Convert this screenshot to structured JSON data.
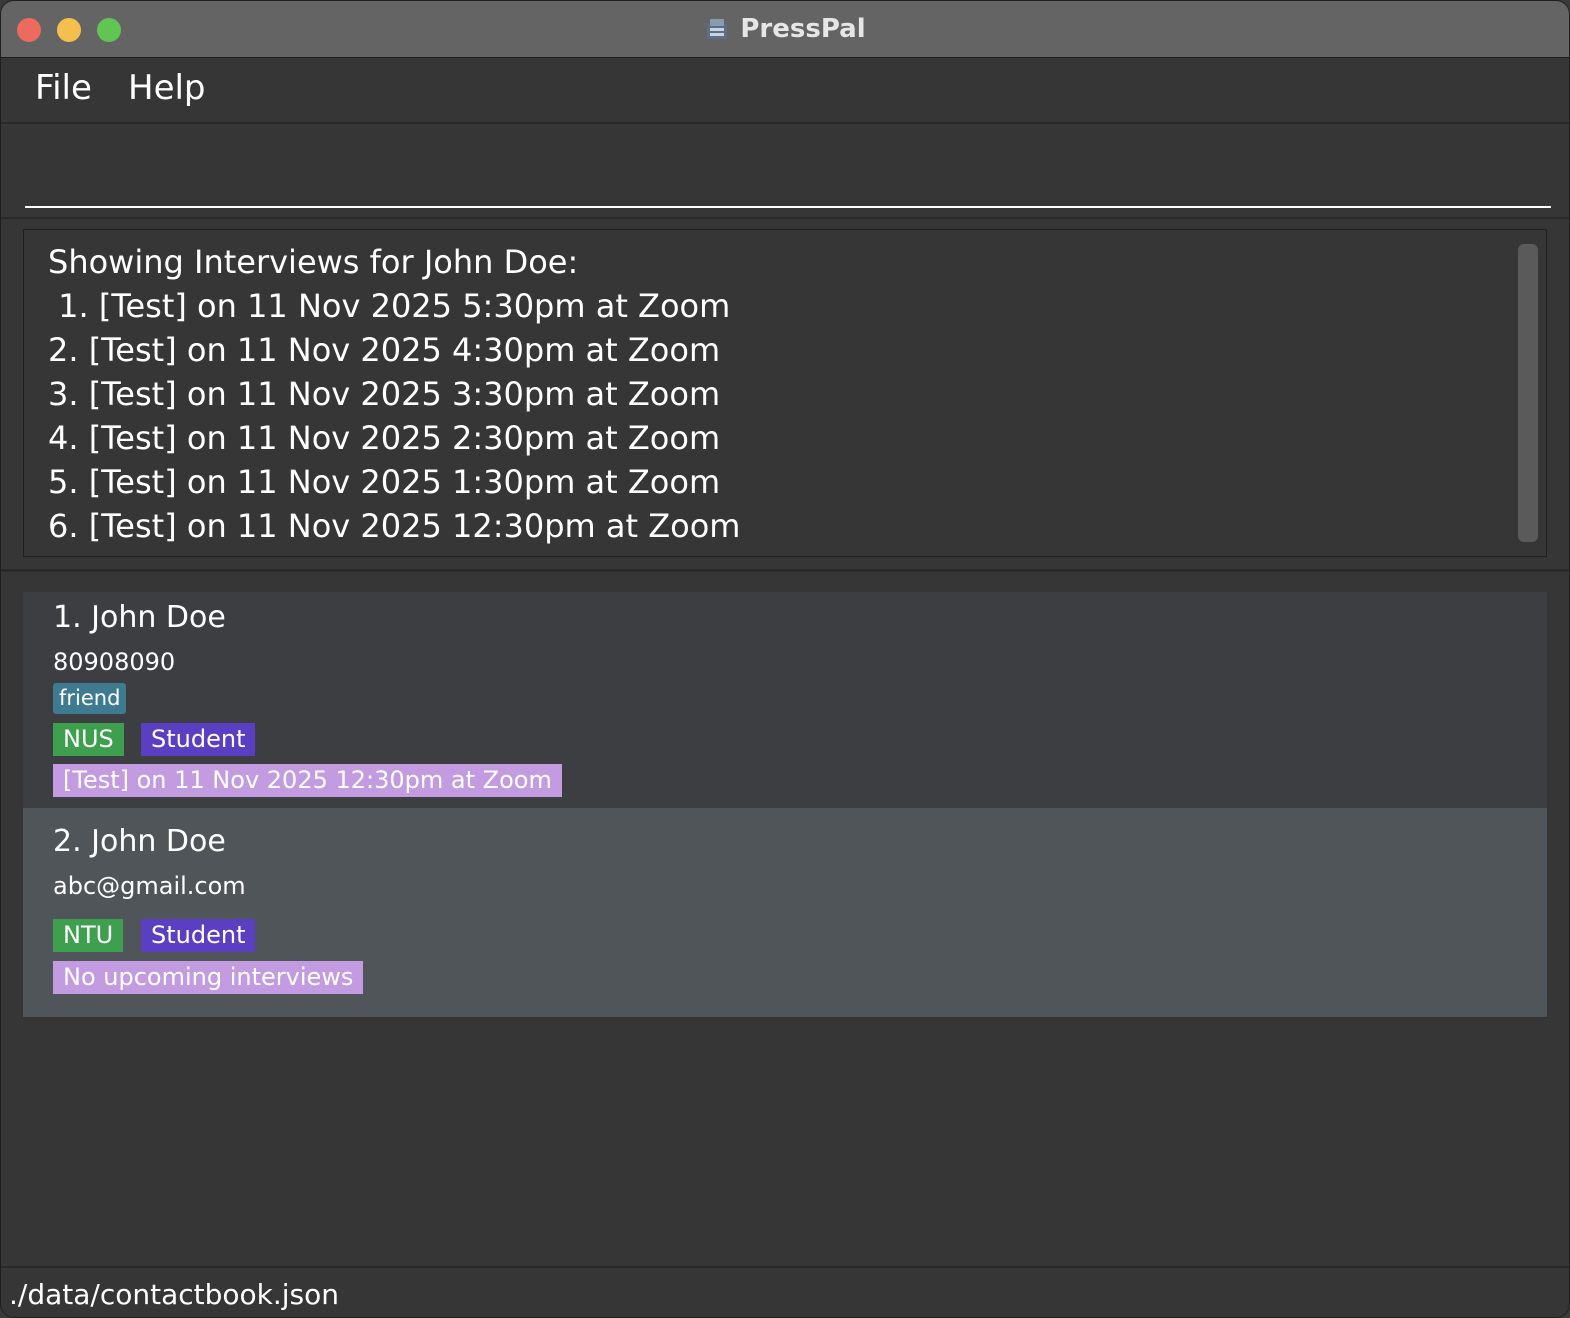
{
  "window": {
    "title": "PressPal",
    "icon": "presspal-app-icon"
  },
  "menu": {
    "file": "File",
    "help": "Help"
  },
  "command": {
    "value": ""
  },
  "result": {
    "text": "Showing Interviews for John Doe:\n 1. [Test] on 11 Nov 2025 5:30pm at Zoom\n2. [Test] on 11 Nov 2025 4:30pm at Zoom\n3. [Test] on 11 Nov 2025 3:30pm at Zoom\n4. [Test] on 11 Nov 2025 2:30pm at Zoom\n5. [Test] on 11 Nov 2025 1:30pm at Zoom\n6. [Test] on 11 Nov 2025 12:30pm at Zoom"
  },
  "contacts": [
    {
      "name": "1. John Doe",
      "detail": "80908090",
      "tag": "friend",
      "organisation": "NUS",
      "role": "Student",
      "interview": "[Test] on 11 Nov 2025 12:30pm at Zoom"
    },
    {
      "name": "2. John  Doe",
      "detail": "abc@gmail.com",
      "organisation": "NTU",
      "role": "Student",
      "interview": "No upcoming interviews"
    }
  ],
  "status": {
    "path": "./data/contactbook.json"
  },
  "colors": {
    "tag_friend": "#3e7b91",
    "org_tag": "#3e9f4e",
    "role_tag": "#5b3fc2",
    "interview_tag": "#c39be0",
    "selected_card": "#4f5558",
    "card": "#3c3e41"
  }
}
